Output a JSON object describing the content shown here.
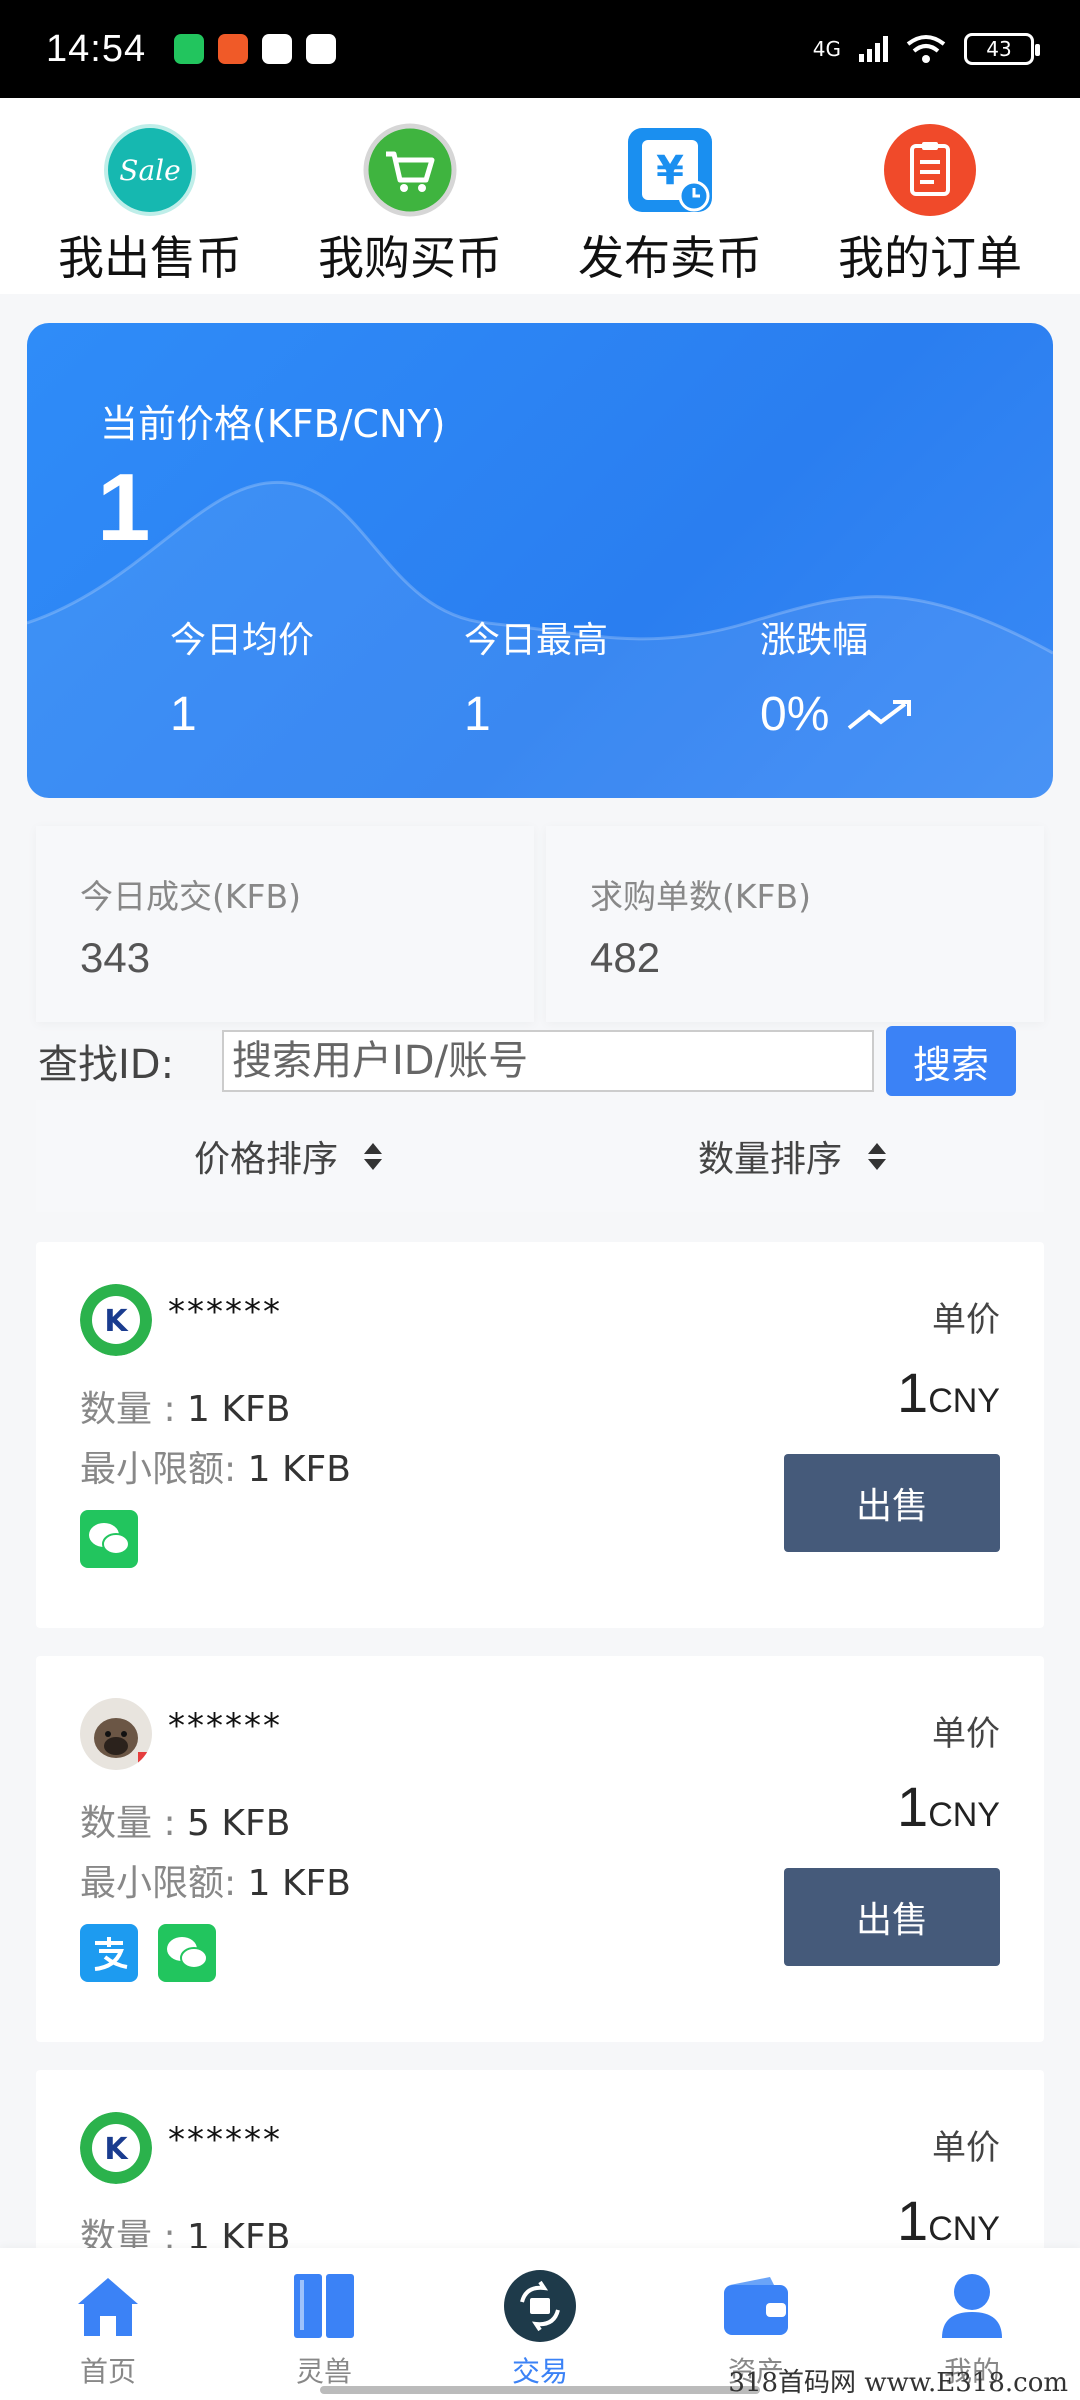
{
  "status_bar": {
    "time": "14:54",
    "network": "4G",
    "battery": "43"
  },
  "top_nav": [
    {
      "label": "我出售币",
      "icon": "sale-icon",
      "badge_text": "Sale"
    },
    {
      "label": "我购买币",
      "icon": "cart-icon"
    },
    {
      "label": "发布卖币",
      "icon": "yuan-clock-icon"
    },
    {
      "label": "我的订单",
      "icon": "clipboard-icon"
    }
  ],
  "price_card": {
    "title": "当前价格(KFB/CNY)",
    "value": "1",
    "stats": [
      {
        "label": "今日均价",
        "value": "1"
      },
      {
        "label": "今日最高",
        "value": "1"
      },
      {
        "label": "涨跌幅",
        "value": "0%"
      }
    ]
  },
  "volume": [
    {
      "label": "今日成交(KFB)",
      "value": "343"
    },
    {
      "label": "求购单数(KFB)",
      "value": "482"
    }
  ],
  "search": {
    "label": "查找ID:",
    "placeholder": "搜索用户ID/账号",
    "button": "搜索"
  },
  "sort": [
    {
      "label": "价格排序"
    },
    {
      "label": "数量排序"
    }
  ],
  "orders": [
    {
      "name": "******",
      "unit_label": "单价",
      "price": "1",
      "currency": "CNY",
      "qty_label": "数量 :",
      "qty": "1 KFB",
      "min_label": "最小限额:",
      "min": "1 KFB",
      "action": "出售",
      "payments": [
        "wechat-pay-icon"
      ],
      "avatar": "k-logo-avatar"
    },
    {
      "name": "******",
      "unit_label": "单价",
      "price": "1",
      "currency": "CNY",
      "qty_label": "数量 :",
      "qty": "5 KFB",
      "min_label": "最小限额:",
      "min": "1 KFB",
      "action": "出售",
      "payments": [
        "alipay-icon",
        "wechat-pay-icon"
      ],
      "avatar": "dog-photo-avatar"
    },
    {
      "name": "******",
      "unit_label": "单价",
      "price": "1",
      "currency": "CNY",
      "qty_label": "数量 :",
      "qty": "1 KFB",
      "avatar": "k-logo-avatar"
    }
  ],
  "tabs": [
    {
      "label": "首页",
      "icon": "home-icon"
    },
    {
      "label": "灵兽",
      "icon": "book-icon"
    },
    {
      "label": "交易",
      "icon": "exchange-icon",
      "active": true
    },
    {
      "label": "资产",
      "icon": "wallet-icon"
    },
    {
      "label": "我的",
      "icon": "user-icon"
    }
  ],
  "watermark": "318首码网 www.E318.com",
  "colors": {
    "accent": "#3b82f6",
    "card": "#2f8cf8",
    "sell_button": "#455a7a"
  }
}
